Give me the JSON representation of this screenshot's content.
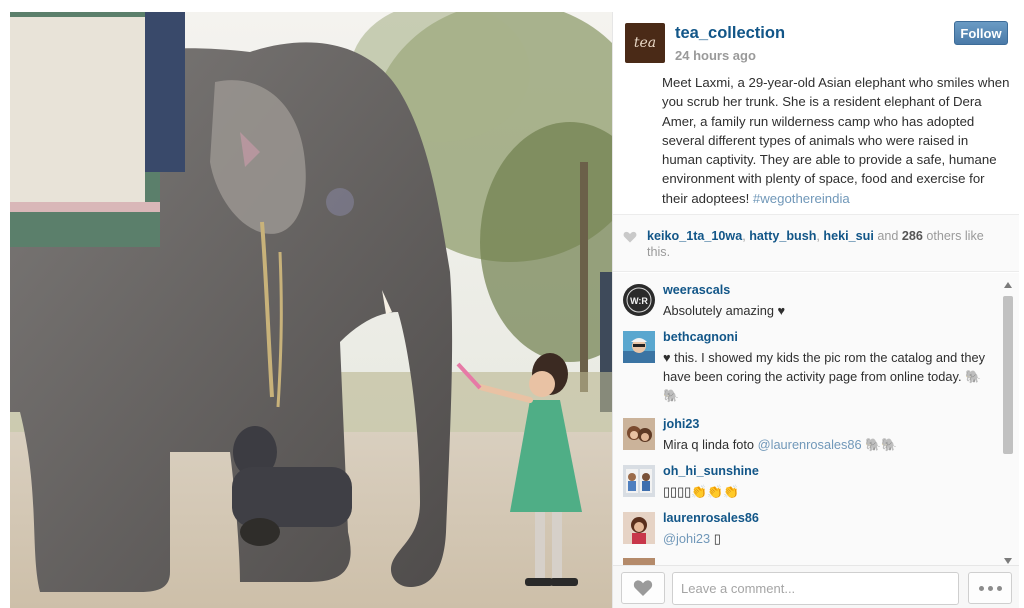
{
  "post": {
    "username": "tea_collection",
    "logo_text": "tea",
    "timestamp": "24 hours ago",
    "follow_label": "Follow",
    "caption": "Meet Laxmi, a 29-year-old Asian elephant who smiles when you scrub her trunk. She is a resident elephant of Dera Amer, a family run wilderness camp who has adopted several different types of animals who were raised in human captivity. They are able to provide a safe, humane environment with plenty of space, food and exercise for their adoptees!",
    "hashtag": "#wegothereindia"
  },
  "likes": {
    "users": [
      "keiko_1ta_10wa",
      "hatty_bush",
      "heki_sui"
    ],
    "and": "and",
    "count": "286",
    "suffix": "others like this."
  },
  "comments": [
    {
      "user": "weerascals",
      "avatar_text": "W:R",
      "text": "Absolutely amazing ♥"
    },
    {
      "user": "bethcagnoni",
      "text": "♥ this. I showed my kids the pic rom the catalog and they have been coring the activity page from online today. 🐘🐘"
    },
    {
      "user": "johi23",
      "text_before": "Mira q linda foto ",
      "mention": "@laurenrosales86",
      "text_after": " 🐘🐘"
    },
    {
      "user": "oh_hi_sunshine",
      "text": "▯▯▯▯👏👏👏"
    },
    {
      "user": "laurenrosales86",
      "mention": "@johi23",
      "text_after": " ▯"
    }
  ],
  "footer": {
    "comment_placeholder": "Leave a comment..."
  },
  "colors": {
    "link": "#125688",
    "hashtag": "#7198b9",
    "follow_button": "#4a7aa8"
  },
  "icons": {
    "like": "heart-icon",
    "more": "ellipsis-icon"
  }
}
